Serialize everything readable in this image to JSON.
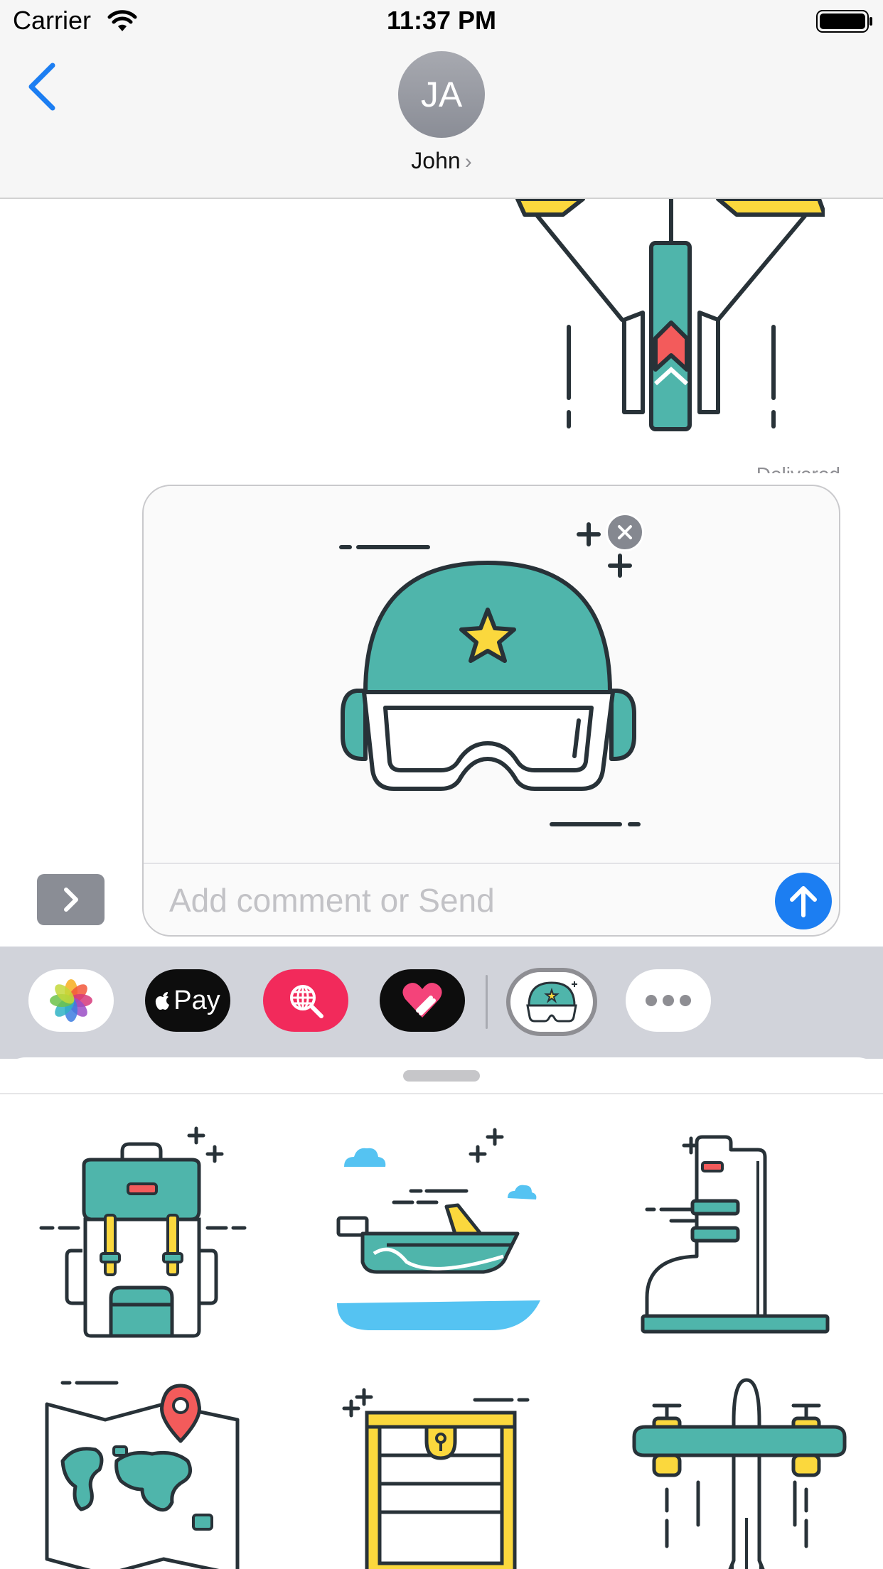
{
  "status_bar": {
    "carrier": "Carrier",
    "time": "11:37 PM"
  },
  "header": {
    "avatar_initials": "JA",
    "contact_name": "John"
  },
  "transcript": {
    "status_text": "Delivered"
  },
  "compose": {
    "placeholder": "Add comment or Send"
  },
  "app_strip": {
    "apple_pay_label": "Pay",
    "items": [
      "photos-app",
      "apple-pay-app",
      "search-images-app",
      "digital-touch-app",
      "army-stickers-app",
      "more-apps"
    ]
  },
  "stickers": [
    "backpack-sticker",
    "speedboat-sticker",
    "boot-sticker",
    "map-sticker",
    "treasure-chest-sticker",
    "airplane-sticker"
  ],
  "colors": {
    "teal": "#4fb5ab",
    "yellow": "#fbd83d",
    "red": "#f35b5b",
    "outline": "#283238",
    "water": "#55c3f2",
    "ios_blue": "#1c7ef2"
  }
}
